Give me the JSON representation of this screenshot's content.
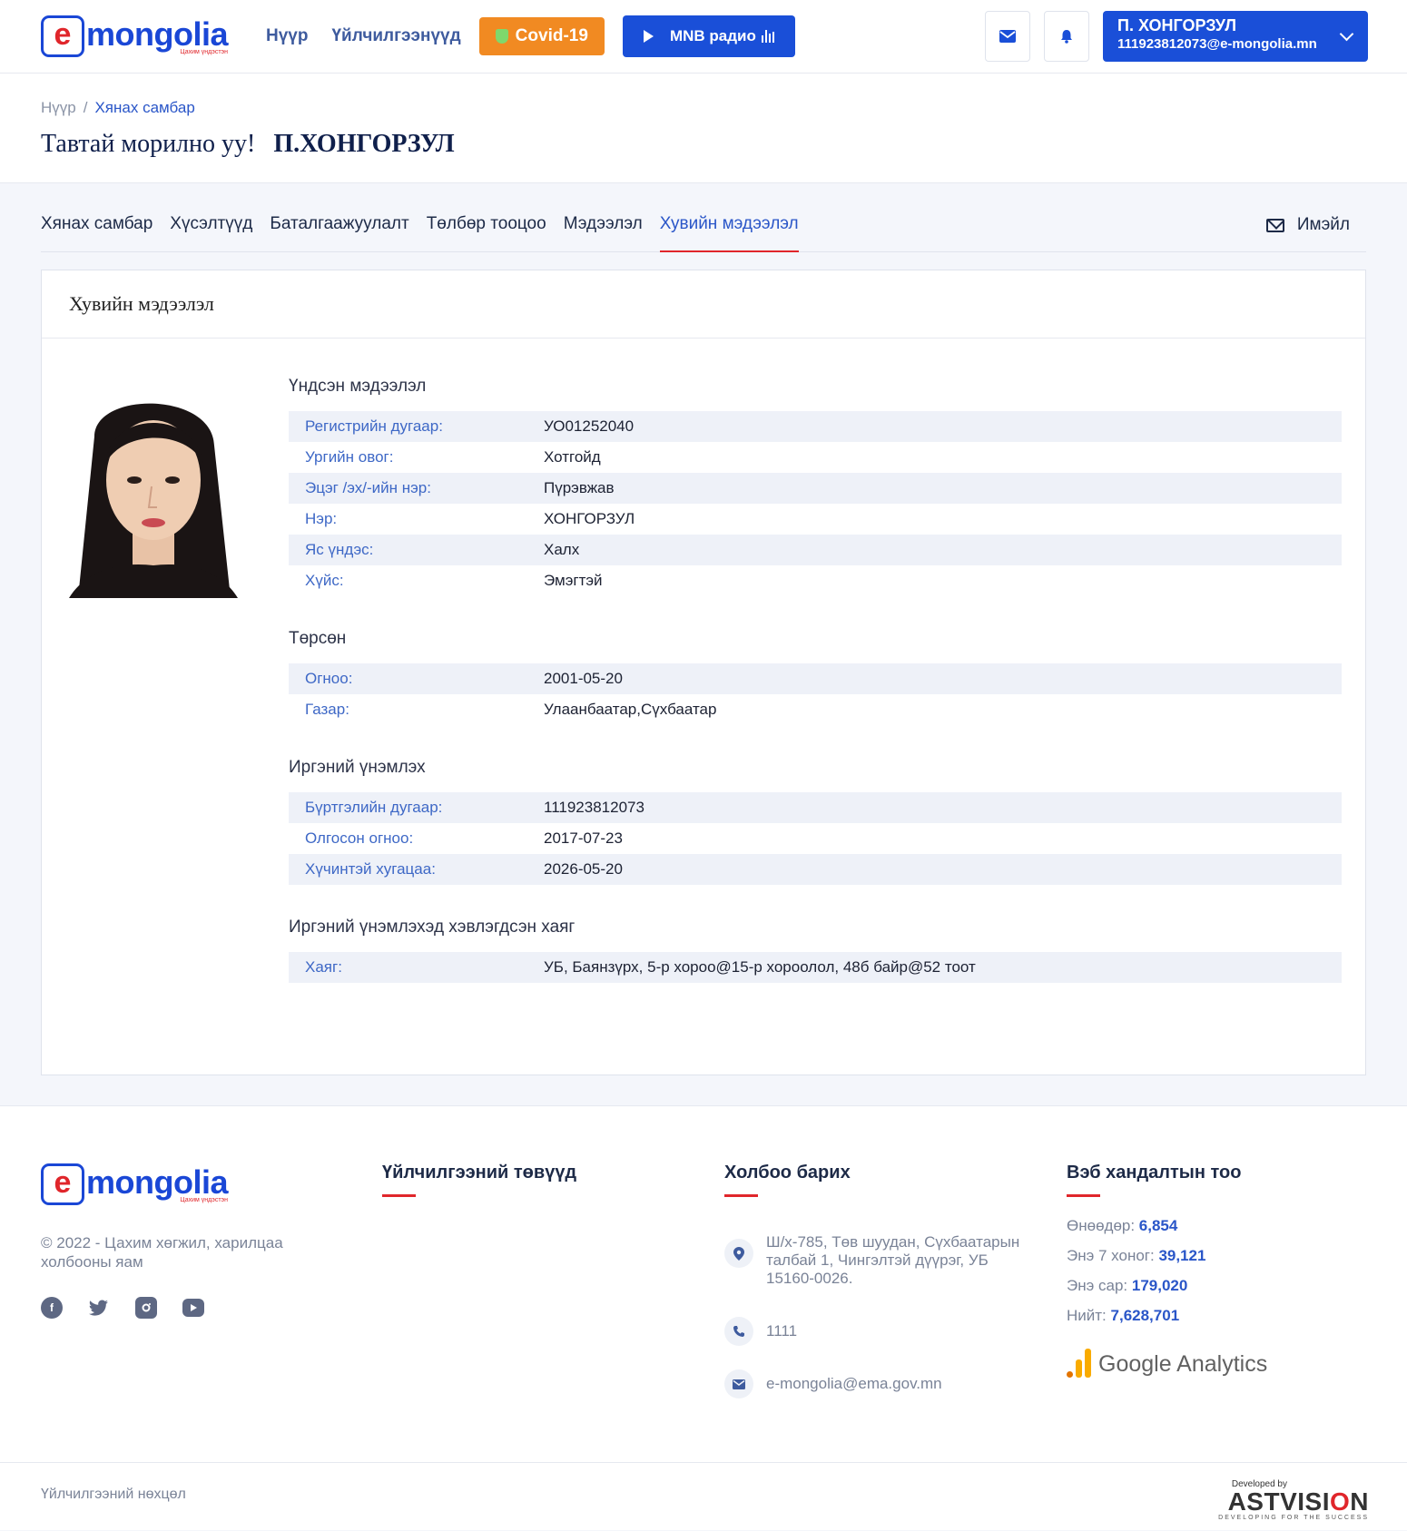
{
  "header": {
    "logo_text": "mongolia",
    "logo_letter": "e",
    "logo_sub": "Цахим үндэстэн",
    "nav": [
      "Нүүр",
      "Үйлчилгээнүүд"
    ],
    "covid_label": "Covid-19",
    "radio_label": "MNB радио",
    "user_name": "П. ХОНГОРЗУЛ",
    "user_email": "111923812073@e-mongolia.mn",
    "accent": "#1a4fd8"
  },
  "breadcrumb": [
    "Нүүр",
    "Хянах самбар"
  ],
  "welcome": {
    "greeting": "Тавтай морилно уу!",
    "name": "П.ХОНГОРЗУЛ"
  },
  "tabs": [
    "Хянах самбар",
    "Хүсэлтүүд",
    "Баталгаажуулалт",
    "Төлбөр тооцоо",
    "Мэдээлэл",
    "Хувийн мэдээлэл"
  ],
  "active_tab": "Хувийн мэдээлэл",
  "email_tab": "Имэйл",
  "card": {
    "title": "Хувийн мэдээлэл",
    "sections": [
      {
        "title": "Үндсэн мэдээлэл",
        "rows": [
          {
            "label": "Регистрийн дугаар:",
            "value": "УО01252040"
          },
          {
            "label": "Ургийн овог:",
            "value": "Хотгойд"
          },
          {
            "label": "Эцэг /эх/-ийн нэр:",
            "value": "Пүрэвжав"
          },
          {
            "label": "Нэр:",
            "value": "ХОНГОРЗУЛ"
          },
          {
            "label": "Яс үндэс:",
            "value": "Халх"
          },
          {
            "label": "Хүйс:",
            "value": "Эмэгтэй"
          }
        ]
      },
      {
        "title": "Төрсөн",
        "rows": [
          {
            "label": "Огноо:",
            "value": "2001-05-20"
          },
          {
            "label": "Газар:",
            "value": "Улаанбаатар,Сүхбаатар"
          }
        ]
      },
      {
        "title": "Иргэний үнэмлэх",
        "rows": [
          {
            "label": "Бүртгэлийн дугаар:",
            "value": "111923812073"
          },
          {
            "label": "Олгосон огноо:",
            "value": "2017-07-23"
          },
          {
            "label": "Хүчинтэй хугацаа:",
            "value": "2026-05-20"
          }
        ]
      },
      {
        "title": "Иргэний үнэмлэхэд хэвлэгдсэн хаяг",
        "rows": [
          {
            "label": "Хаяг:",
            "value": "УБ, Баянзүрх, 5-р хороо@15-р хороолол, 48б байр@52 тоот"
          }
        ]
      }
    ]
  },
  "footer": {
    "copyright": "© 2022 - Цахим хөгжил, харилцаа холбооны яам",
    "services_title": "Үйлчилгээний төвүүд",
    "contact_title": "Холбоо барих",
    "address": "Ш/х-785, Төв шуудан, Сүхбаатарын талбай 1, Чингэлтэй дүүрэг, УБ 15160-0026.",
    "phone": "1111",
    "email": "e-mongolia@ema.gov.mn",
    "stats_title": "Вэб хандалтын тоо",
    "stats": [
      {
        "label": "Өнөөдөр: ",
        "value": "6,854"
      },
      {
        "label": "Энэ 7 хоног: ",
        "value": "39,121"
      },
      {
        "label": "Энэ сар: ",
        "value": "179,020"
      },
      {
        "label": "Нийт: ",
        "value": "7,628,701"
      }
    ],
    "ga_label": "Google Analytics",
    "terms": "Үйлчилгээний нөхцөл",
    "dev_by": "Developed by",
    "dev_brand_a": "ASTVISI",
    "dev_brand_o": "O",
    "dev_brand_b": "N",
    "dev_tagline": "DEVELOPING FOR THE SUCCESS"
  }
}
